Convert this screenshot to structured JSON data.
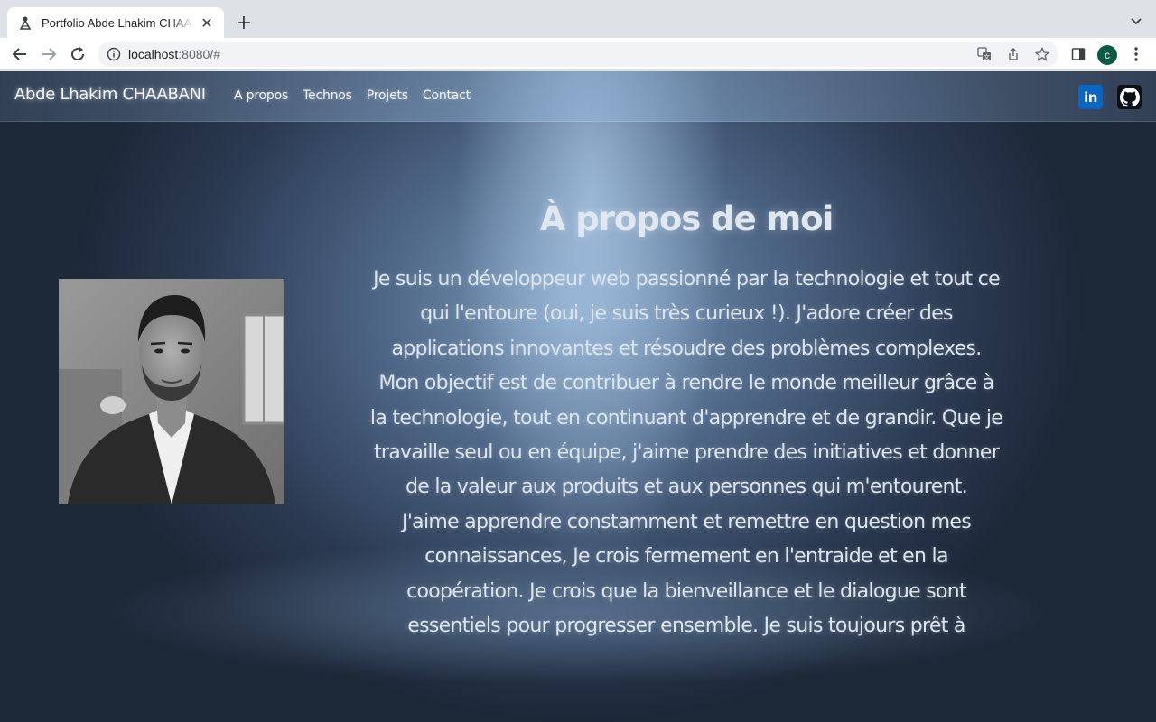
{
  "browser": {
    "tab_title": "Portfolio Abde Lhakim CHAABANI",
    "url_host": "localhost",
    "url_rest": ":8080/#",
    "profile_initial": "c"
  },
  "site": {
    "brand": "Abde Lhakim CHAABANI",
    "nav": [
      "A propos",
      "Technos",
      "Projets",
      "Contact"
    ],
    "social": {
      "linkedin": "in"
    }
  },
  "about": {
    "heading": "À propos de moi",
    "paragraphs": [
      "Je suis un développeur web passionné par la technologie et tout ce qui l'entoure (oui, je suis très curieux !). J'adore créer des applications innovantes et résoudre des problèmes complexes.",
      "Mon objectif est de contribuer à rendre le monde meilleur grâce à la technologie, tout en continuant d'apprendre et de grandir. Que je travaille seul ou en équipe, j'aime prendre des initiatives et donner de la valeur aux produits et aux personnes qui m'entourent.",
      "J'aime apprendre constamment et remettre en question mes connaissances, Je crois fermement en l'entraide et en la coopération. Je crois que la bienveillance et le dialogue sont essentiels pour progresser ensemble. Je suis toujours prêt à"
    ]
  },
  "colors": {
    "linkedin": "#0a66c2",
    "github": "#0d1117",
    "profile": "#0b5a45"
  }
}
